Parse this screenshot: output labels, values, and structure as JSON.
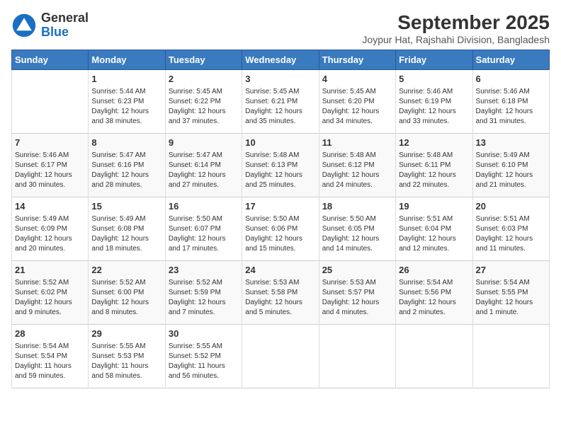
{
  "header": {
    "logo_general": "General",
    "logo_blue": "Blue",
    "month_title": "September 2025",
    "location": "Joypur Hat, Rajshahi Division, Bangladesh"
  },
  "days_of_week": [
    "Sunday",
    "Monday",
    "Tuesday",
    "Wednesday",
    "Thursday",
    "Friday",
    "Saturday"
  ],
  "weeks": [
    [
      {
        "day": "",
        "info": ""
      },
      {
        "day": "1",
        "info": "Sunrise: 5:44 AM\nSunset: 6:23 PM\nDaylight: 12 hours\nand 38 minutes."
      },
      {
        "day": "2",
        "info": "Sunrise: 5:45 AM\nSunset: 6:22 PM\nDaylight: 12 hours\nand 37 minutes."
      },
      {
        "day": "3",
        "info": "Sunrise: 5:45 AM\nSunset: 6:21 PM\nDaylight: 12 hours\nand 35 minutes."
      },
      {
        "day": "4",
        "info": "Sunrise: 5:45 AM\nSunset: 6:20 PM\nDaylight: 12 hours\nand 34 minutes."
      },
      {
        "day": "5",
        "info": "Sunrise: 5:46 AM\nSunset: 6:19 PM\nDaylight: 12 hours\nand 33 minutes."
      },
      {
        "day": "6",
        "info": "Sunrise: 5:46 AM\nSunset: 6:18 PM\nDaylight: 12 hours\nand 31 minutes."
      }
    ],
    [
      {
        "day": "7",
        "info": "Sunrise: 5:46 AM\nSunset: 6:17 PM\nDaylight: 12 hours\nand 30 minutes."
      },
      {
        "day": "8",
        "info": "Sunrise: 5:47 AM\nSunset: 6:16 PM\nDaylight: 12 hours\nand 28 minutes."
      },
      {
        "day": "9",
        "info": "Sunrise: 5:47 AM\nSunset: 6:14 PM\nDaylight: 12 hours\nand 27 minutes."
      },
      {
        "day": "10",
        "info": "Sunrise: 5:48 AM\nSunset: 6:13 PM\nDaylight: 12 hours\nand 25 minutes."
      },
      {
        "day": "11",
        "info": "Sunrise: 5:48 AM\nSunset: 6:12 PM\nDaylight: 12 hours\nand 24 minutes."
      },
      {
        "day": "12",
        "info": "Sunrise: 5:48 AM\nSunset: 6:11 PM\nDaylight: 12 hours\nand 22 minutes."
      },
      {
        "day": "13",
        "info": "Sunrise: 5:49 AM\nSunset: 6:10 PM\nDaylight: 12 hours\nand 21 minutes."
      }
    ],
    [
      {
        "day": "14",
        "info": "Sunrise: 5:49 AM\nSunset: 6:09 PM\nDaylight: 12 hours\nand 20 minutes."
      },
      {
        "day": "15",
        "info": "Sunrise: 5:49 AM\nSunset: 6:08 PM\nDaylight: 12 hours\nand 18 minutes."
      },
      {
        "day": "16",
        "info": "Sunrise: 5:50 AM\nSunset: 6:07 PM\nDaylight: 12 hours\nand 17 minutes."
      },
      {
        "day": "17",
        "info": "Sunrise: 5:50 AM\nSunset: 6:06 PM\nDaylight: 12 hours\nand 15 minutes."
      },
      {
        "day": "18",
        "info": "Sunrise: 5:50 AM\nSunset: 6:05 PM\nDaylight: 12 hours\nand 14 minutes."
      },
      {
        "day": "19",
        "info": "Sunrise: 5:51 AM\nSunset: 6:04 PM\nDaylight: 12 hours\nand 12 minutes."
      },
      {
        "day": "20",
        "info": "Sunrise: 5:51 AM\nSunset: 6:03 PM\nDaylight: 12 hours\nand 11 minutes."
      }
    ],
    [
      {
        "day": "21",
        "info": "Sunrise: 5:52 AM\nSunset: 6:02 PM\nDaylight: 12 hours\nand 9 minutes."
      },
      {
        "day": "22",
        "info": "Sunrise: 5:52 AM\nSunset: 6:00 PM\nDaylight: 12 hours\nand 8 minutes."
      },
      {
        "day": "23",
        "info": "Sunrise: 5:52 AM\nSunset: 5:59 PM\nDaylight: 12 hours\nand 7 minutes."
      },
      {
        "day": "24",
        "info": "Sunrise: 5:53 AM\nSunset: 5:58 PM\nDaylight: 12 hours\nand 5 minutes."
      },
      {
        "day": "25",
        "info": "Sunrise: 5:53 AM\nSunset: 5:57 PM\nDaylight: 12 hours\nand 4 minutes."
      },
      {
        "day": "26",
        "info": "Sunrise: 5:54 AM\nSunset: 5:56 PM\nDaylight: 12 hours\nand 2 minutes."
      },
      {
        "day": "27",
        "info": "Sunrise: 5:54 AM\nSunset: 5:55 PM\nDaylight: 12 hours\nand 1 minute."
      }
    ],
    [
      {
        "day": "28",
        "info": "Sunrise: 5:54 AM\nSunset: 5:54 PM\nDaylight: 11 hours\nand 59 minutes."
      },
      {
        "day": "29",
        "info": "Sunrise: 5:55 AM\nSunset: 5:53 PM\nDaylight: 11 hours\nand 58 minutes."
      },
      {
        "day": "30",
        "info": "Sunrise: 5:55 AM\nSunset: 5:52 PM\nDaylight: 11 hours\nand 56 minutes."
      },
      {
        "day": "",
        "info": ""
      },
      {
        "day": "",
        "info": ""
      },
      {
        "day": "",
        "info": ""
      },
      {
        "day": "",
        "info": ""
      }
    ]
  ]
}
